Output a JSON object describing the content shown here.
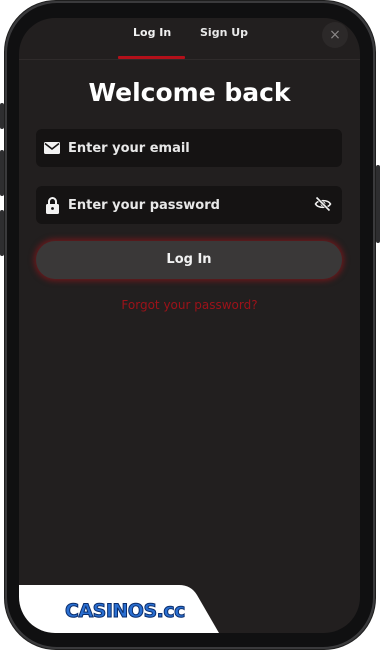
{
  "tabs": {
    "login_label": "Log In",
    "signup_label": "Sign Up",
    "close_glyph": "×"
  },
  "title": "Welcome back",
  "email": {
    "placeholder": "Enter your email",
    "value": "",
    "icon": "envelope-icon"
  },
  "password": {
    "placeholder": "Enter your password",
    "value": "",
    "icon": "lock-icon",
    "toggle_icon": "eye-slash-icon"
  },
  "login_button": "Log In",
  "forgot_link": "Forgot your password?",
  "watermark": "CASINOS.cc",
  "colors": {
    "background": "#221f1f",
    "accent": "#b3101a",
    "field": "#151313",
    "button": "#3a3838"
  }
}
